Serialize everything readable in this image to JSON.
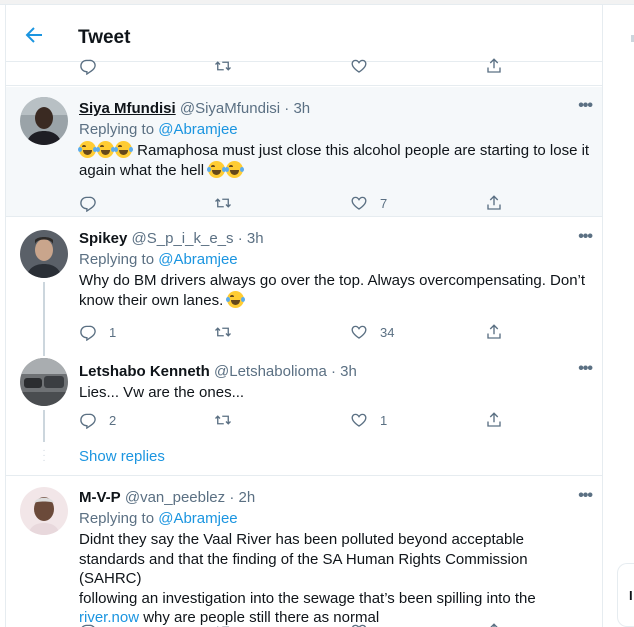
{
  "header": {
    "title": "Tweet"
  },
  "colors": {
    "accent": "#1b95e0",
    "muted": "#5b7083",
    "highlight_bg": "#f5f8fa"
  },
  "tweets": [
    {
      "name": "Siya Mfundisi",
      "handle": "@SiyaMfundisi",
      "time": "3h",
      "replying_prefix": "Replying to",
      "replying_to": "@Abramjee",
      "text": "Ramaphosa must just close this alcohol people are starting to lose it again what the hell",
      "replies": "",
      "retweets": "",
      "likes": "7"
    },
    {
      "name": "Spikey",
      "handle": "@S_p_i_k_e_s",
      "time": "3h",
      "replying_prefix": "Replying to",
      "replying_to": "@Abramjee",
      "text": "Why do BM drivers always go over the top. Always overcompensating. Don’t know their own lanes.",
      "replies": "1",
      "retweets": "",
      "likes": "34"
    },
    {
      "name": "Letshabo Kenneth",
      "handle": "@Letshabolioma",
      "time": "3h",
      "text": "Lies... Vw are the ones...",
      "replies": "2",
      "retweets": "",
      "likes": "1"
    },
    {
      "name": "M-V-P",
      "handle": "@van_peeblez",
      "time": "2h",
      "replying_prefix": "Replying to",
      "replying_to": "@Abramjee",
      "text_lines": [
        "Didnt they say the Vaal River has been polluted beyond acceptable",
        "standards and that the finding of the SA Human Rights Commission (SAHRC)",
        "following an investigation into the sewage that’s been spilling into the"
      ],
      "text_link": "river.now",
      "text_after_link": " why are people still there as normal"
    }
  ],
  "show_replies": "Show replies",
  "right_pane": {
    "letter": "I"
  },
  "icons": [
    "back-arrow-icon",
    "reply-icon",
    "retweet-icon",
    "like-icon",
    "share-icon",
    "more-icon",
    "face-with-tears-of-joy-emoji",
    "rolling-on-floor-laughing-emoji"
  ]
}
